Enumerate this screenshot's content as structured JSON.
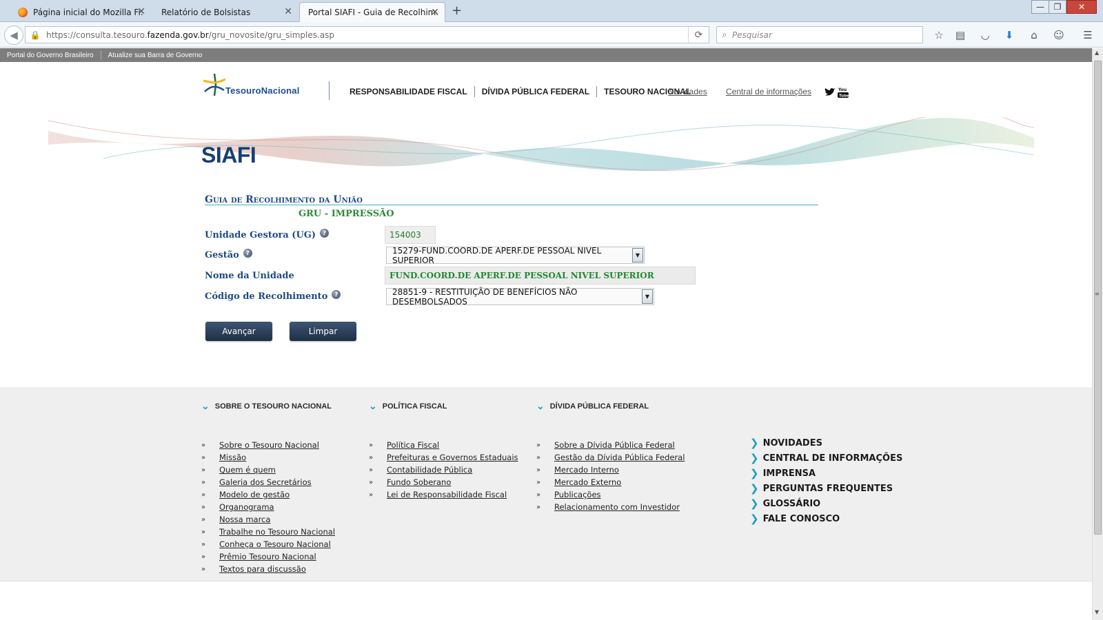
{
  "browser": {
    "tabs": [
      {
        "label": "Página inicial do Mozilla Fi...",
        "active": false
      },
      {
        "label": "Relatório de Bolsistas",
        "active": false
      },
      {
        "label": "Portal SIAFI - Guia de Recolhim...",
        "active": true
      }
    ],
    "new_tab": "+",
    "url_prefix": "https://consulta.tesouro.",
    "url_domain": "fazenda.gov.br",
    "url_path": "/gru_novosite/gru_simples.asp",
    "search_placeholder": "Pesquisar",
    "icons": [
      "back-icon",
      "lock-icon",
      "reload-icon",
      "search-icon",
      "bookmark-star-icon",
      "reading-list-icon",
      "pocket-icon",
      "download-icon",
      "home-icon",
      "chat-icon",
      "menu-icon"
    ]
  },
  "govbar": {
    "portal": "Portal do Governo Brasileiro",
    "atualize": "Atualize sua Barra de Governo"
  },
  "header": {
    "logo_text": "TesouroNacional",
    "nav": [
      "RESPONSABILIDADE FISCAL",
      "DÍVIDA PÚBLICA FEDERAL",
      "TESOURO NACIONAL"
    ],
    "novidades": "Novidades",
    "central": "Central de informações",
    "page_title": "SIAFI"
  },
  "form": {
    "title": "Guia de Recolhimento da União",
    "subtitle": "GRU - IMPRESSÃO",
    "ug_label": "Unidade Gestora (UG)",
    "ug_value": "154003",
    "gestao_label": "Gestão",
    "gestao_value": "15279-FUND.COORD.DE APERF.DE PESSOAL NIVEL SUPERIOR",
    "nome_label": "Nome da Unidade",
    "nome_value": "FUND.COORD.DE APERF.DE PESSOAL NIVEL SUPERIOR",
    "codigo_label": "Código de Recolhimento",
    "codigo_value": "28851-9 - RESTITUIÇÃO DE BENEFÍCIOS NÃO DESEMBOLSADOS",
    "avancar": "Avançar",
    "limpar": "Limpar"
  },
  "footer": {
    "col1": {
      "title": "SOBRE O TESOURO NACIONAL",
      "links": [
        "Sobre o Tesouro Nacional",
        "Missão",
        "Quem é quem",
        "Galeria dos Secretários",
        "Modelo de gestão",
        "Organograma",
        "Nossa marca",
        "Trabalhe no Tesouro Nacional",
        "Conheça o Tesouro Nacional",
        "Prêmio Tesouro Nacional",
        "Textos para discussão"
      ]
    },
    "col2": {
      "title": "POLÍTICA FISCAL",
      "links": [
        "Política Fiscal",
        "Prefeituras e Governos Estaduais",
        "Contabilidade Pública",
        "Fundo Soberano",
        "Lei de Responsabilidade Fiscal"
      ]
    },
    "col3": {
      "title": "DÍVIDA PÚBLICA FEDERAL",
      "links": [
        "Sobre a Dívida Pública Federal",
        "Gestão da Dívida Pública Federal",
        "Mercado Interno",
        "Mercado Externo",
        "Publicações",
        "Relacionamento com Investidor"
      ]
    },
    "quick_links": [
      "NOVIDADES",
      "CENTRAL DE INFORMAÇÕES",
      "IMPRENSA",
      "PERGUNTAS FREQUENTES",
      "GLOSSÁRIO",
      "FALE CONOSCO"
    ]
  },
  "colors": {
    "brand_blue": "#1b4a8d",
    "accent_cyan": "#18a1c8",
    "green_value": "#20882e"
  }
}
